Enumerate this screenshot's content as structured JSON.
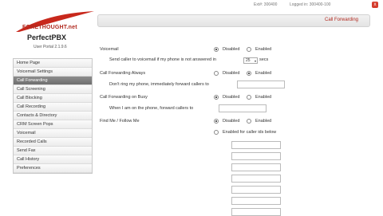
{
  "topbar": {
    "extension": "Ext#: 300400",
    "logged_in": "Logged in: 300400-100",
    "close": "x"
  },
  "logo": {
    "brand_line1": "FORETHOUGHT.net",
    "brand_line2": "PerfectPBX",
    "version": "User Portal 2.1.9.6"
  },
  "nav": {
    "items": [
      {
        "label": "Home Page"
      },
      {
        "label": "Voicemail Settings"
      },
      {
        "label": "Call Forwarding",
        "active": true
      },
      {
        "label": "Call Screening"
      },
      {
        "label": "Call Blocking"
      },
      {
        "label": "Call Recording"
      },
      {
        "label": "Contacts & Directory"
      },
      {
        "label": "CRM Screen Pops"
      },
      {
        "label": "Voicemail"
      },
      {
        "label": "Recorded Calls"
      },
      {
        "label": "Send Fax"
      },
      {
        "label": "Call History"
      },
      {
        "label": "Preferences"
      }
    ]
  },
  "page": {
    "title": "Call Forwarding",
    "voicemail": {
      "label": "Voicemail",
      "disabled": "Disabled",
      "enabled": "Enabled",
      "selected": "disabled",
      "sub_label": "Send caller to voicemail if my phone is not answered in",
      "seconds_value": "25",
      "seconds_unit": "secs"
    },
    "forward_always": {
      "label": "Call Forwarding Always",
      "disabled": "Disabled",
      "enabled": "Enabled",
      "selected": "enabled",
      "sub_label": "Don't ring my phone, immediately forward callers to"
    },
    "forward_busy": {
      "label": "Call Forwarding on Busy",
      "disabled": "Disabled",
      "enabled": "Enabled",
      "selected": "disabled",
      "sub_label": "When I am on the phone, forward callers to"
    },
    "find_me": {
      "label": "Find Me / Follow Me",
      "disabled": "Disabled",
      "enabled": "Enabled",
      "selected": "disabled",
      "enabled_for_callerids": "Enabled for caller ids below"
    }
  }
}
